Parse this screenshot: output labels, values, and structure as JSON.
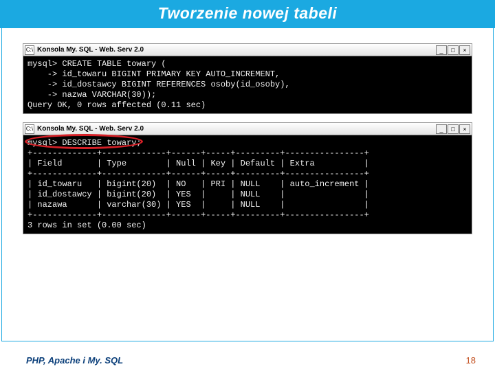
{
  "header": {
    "title": "Tworzenie nowej tabeli"
  },
  "consoles": {
    "window_title": "Konsola My. SQL - Web. Serv 2.0",
    "icon_label": "C:\\",
    "buttons": {
      "min": "_",
      "max": "□",
      "close": "×"
    }
  },
  "terminal1": {
    "l1": "mysql> CREATE TABLE towary (",
    "l2": "    -> id_towaru BIGINT PRIMARY KEY AUTO_INCREMENT,",
    "l3": "    -> id_dostawcy BIGINT REFERENCES osoby(id_osoby),",
    "l4": "    -> nazwa VARCHAR(30));",
    "l5": "Query OK, 0 rows affected (0.11 sec)",
    "l6": ""
  },
  "terminal2": {
    "l1": "mysql> DESCRIBE towary;",
    "l2": "+-------------+-------------+------+-----+---------+----------------+",
    "l3": "| Field       | Type        | Null | Key | Default | Extra          |",
    "l4": "+-------------+-------------+------+-----+---------+----------------+",
    "l5": "| id_towaru   | bigint(20)  | NO   | PRI | NULL    | auto_increment |",
    "l6": "| id_dostawcy | bigint(20)  | YES  |     | NULL    |                |",
    "l7": "| nazawa      | varchar(30) | YES  |     | NULL    |                |",
    "l8": "+-------------+-------------+------+-----+---------+----------------+",
    "l9": "3 rows in set (0.00 sec)",
    "l10": ""
  },
  "footer": {
    "left": "PHP, Apache i My. SQL",
    "right": "18"
  }
}
